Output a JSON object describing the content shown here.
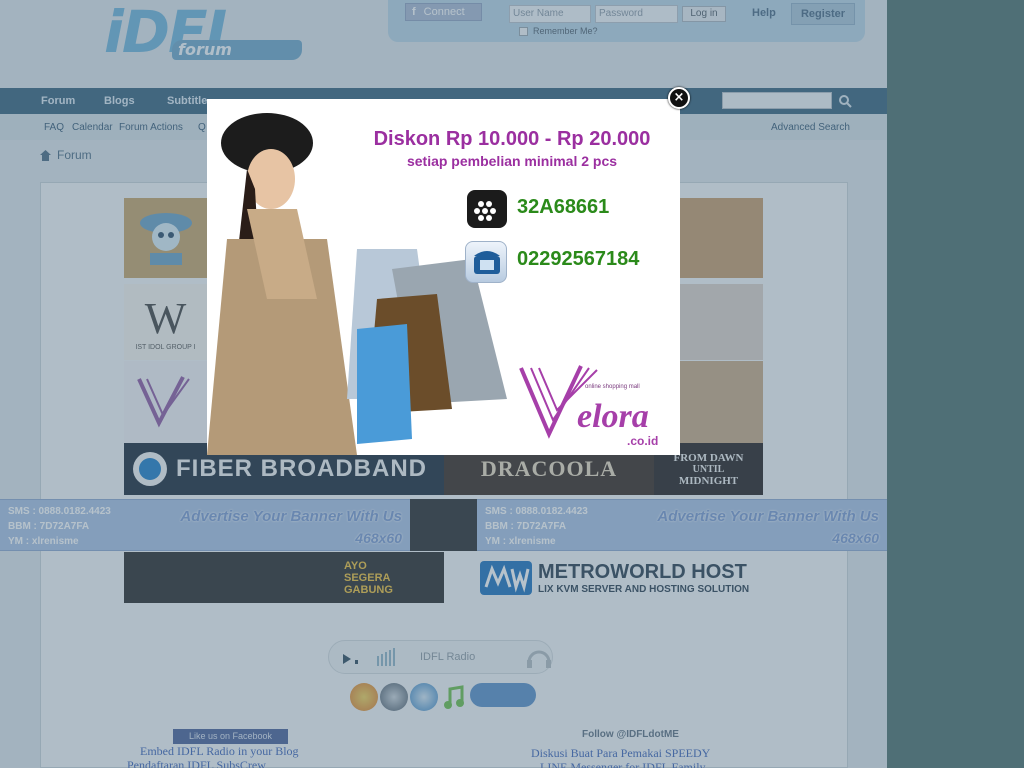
{
  "header": {
    "logo_text": "iDFL",
    "logo_sub": "forum",
    "connect_label": "Connect",
    "username_placeholder": "User Name",
    "password_placeholder": "Password",
    "login_label": "Log in",
    "remember_label": "Remember Me?",
    "help_label": "Help",
    "register_label": "Register"
  },
  "nav": {
    "items": [
      "Forum",
      "Blogs",
      "Subtitle"
    ]
  },
  "subnav": {
    "items": [
      "FAQ",
      "Calendar",
      "Forum Actions",
      "Q"
    ],
    "advanced_search": "Advanced Search"
  },
  "breadcrumb": {
    "home_label": "Forum"
  },
  "banners": {
    "fiber": "FIBER BROADBAND",
    "dracoola": "DRACOOLA",
    "dawn_line1": "FROM DAWN",
    "dawn_line2": "UNTIL",
    "dawn_line3": "MIDNIGHT",
    "metroworld_title": "METROWORLD HOST",
    "metroworld_sub": "LIX KVM SERVER AND HOSTING SOLUTION",
    "idol_letter": "W",
    "idol_caption": "IST IDOL GROUP I",
    "ayo_text": "AYO SEGERA GABUNG"
  },
  "advertise": {
    "sms": "SMS : 0888.0182.4423",
    "bbm": "BBM : 7D72A7FA",
    "ym": "YM : xlrenisme",
    "title": "Advertise Your Banner With Us",
    "size": "468x60"
  },
  "radio": {
    "label": "IDFL Radio"
  },
  "footer": {
    "fb_like": "Like us on Facebook",
    "embed_link": "Embed IDFL Radio in your Blog",
    "subs_link": "Pendaftaran IDFL SubsCrew",
    "twitter": "Follow @IDFLdotME",
    "speedy_link": "Diskusi Buat Para Pemakai SPEEDY",
    "line_link": "LINE Messenger for IDFL Family"
  },
  "popup": {
    "headline": "Diskon Rp 10.000 - Rp 20.000",
    "subline": "setiap pembelian minimal 2 pcs",
    "bbm_pin": "32A68661",
    "phone": "02292567184",
    "brand": "elora",
    "brand_domain": ".co.id",
    "brand_tagline": "online shopping mall",
    "close_label": "×"
  },
  "colors": {
    "accent_purple": "#9b2fa0",
    "contact_green": "#2b8a1a",
    "nav_blue": "#38627d",
    "overlay": "#4f6f76"
  }
}
